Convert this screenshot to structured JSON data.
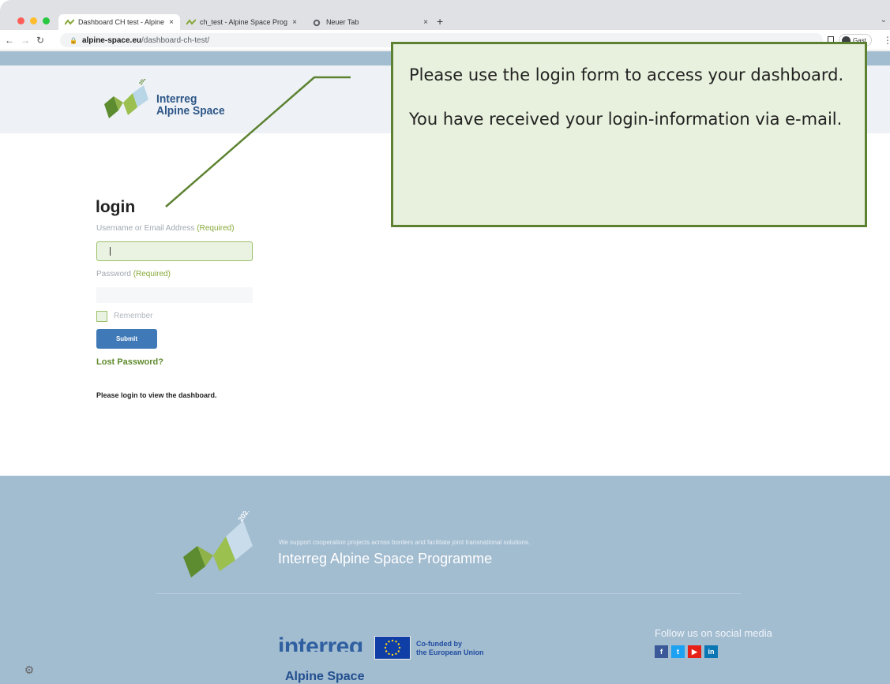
{
  "browser": {
    "tabs": [
      {
        "title": "Dashboard CH test - Alpine Sp",
        "active": true
      },
      {
        "title": "ch_test - Alpine Space Prograi",
        "active": false
      },
      {
        "title": "Neuer Tab",
        "active": false
      }
    ],
    "url_domain": "alpine-space.eu",
    "url_path": "/dashboard-ch-test/",
    "profile_label": "Gast"
  },
  "site": {
    "logo_line1": "Interreg",
    "logo_line2": "Alpine Space",
    "logo_badge": "2021",
    "brand_colors": {
      "green": "#86a838",
      "blue": "#2c5587",
      "footer_bg": "#a2bcd0"
    }
  },
  "login": {
    "title": "login",
    "username_label": "Username or Email Address",
    "username_required": "(Required)",
    "username_value": "",
    "password_label": "Password",
    "password_required": "(Required)",
    "remember_label": "Remember",
    "remember_checked": false,
    "submit_label": "Submit",
    "lost_password": "Lost Password?",
    "message": "Please login to view the dashboard."
  },
  "callout": {
    "line1": "Please use the login form to access your dashboard.",
    "line2": "You have received your login-information via e-mail."
  },
  "footer": {
    "badge": "2021",
    "tagline": "We support cooperation projects across borders and facilitate joint transnational solutions.",
    "title": "Interreg Alpine Space Programme",
    "interreg_word": "interreg",
    "cofunded": "Co-funded by",
    "eu": "the European Union",
    "alpine_space": "Alpine Space",
    "social_title": "Follow us on social media",
    "social": [
      {
        "name": "facebook",
        "glyph": "f"
      },
      {
        "name": "twitter",
        "glyph": "t"
      },
      {
        "name": "youtube",
        "glyph": "▶"
      },
      {
        "name": "linkedin",
        "glyph": "in"
      }
    ]
  }
}
